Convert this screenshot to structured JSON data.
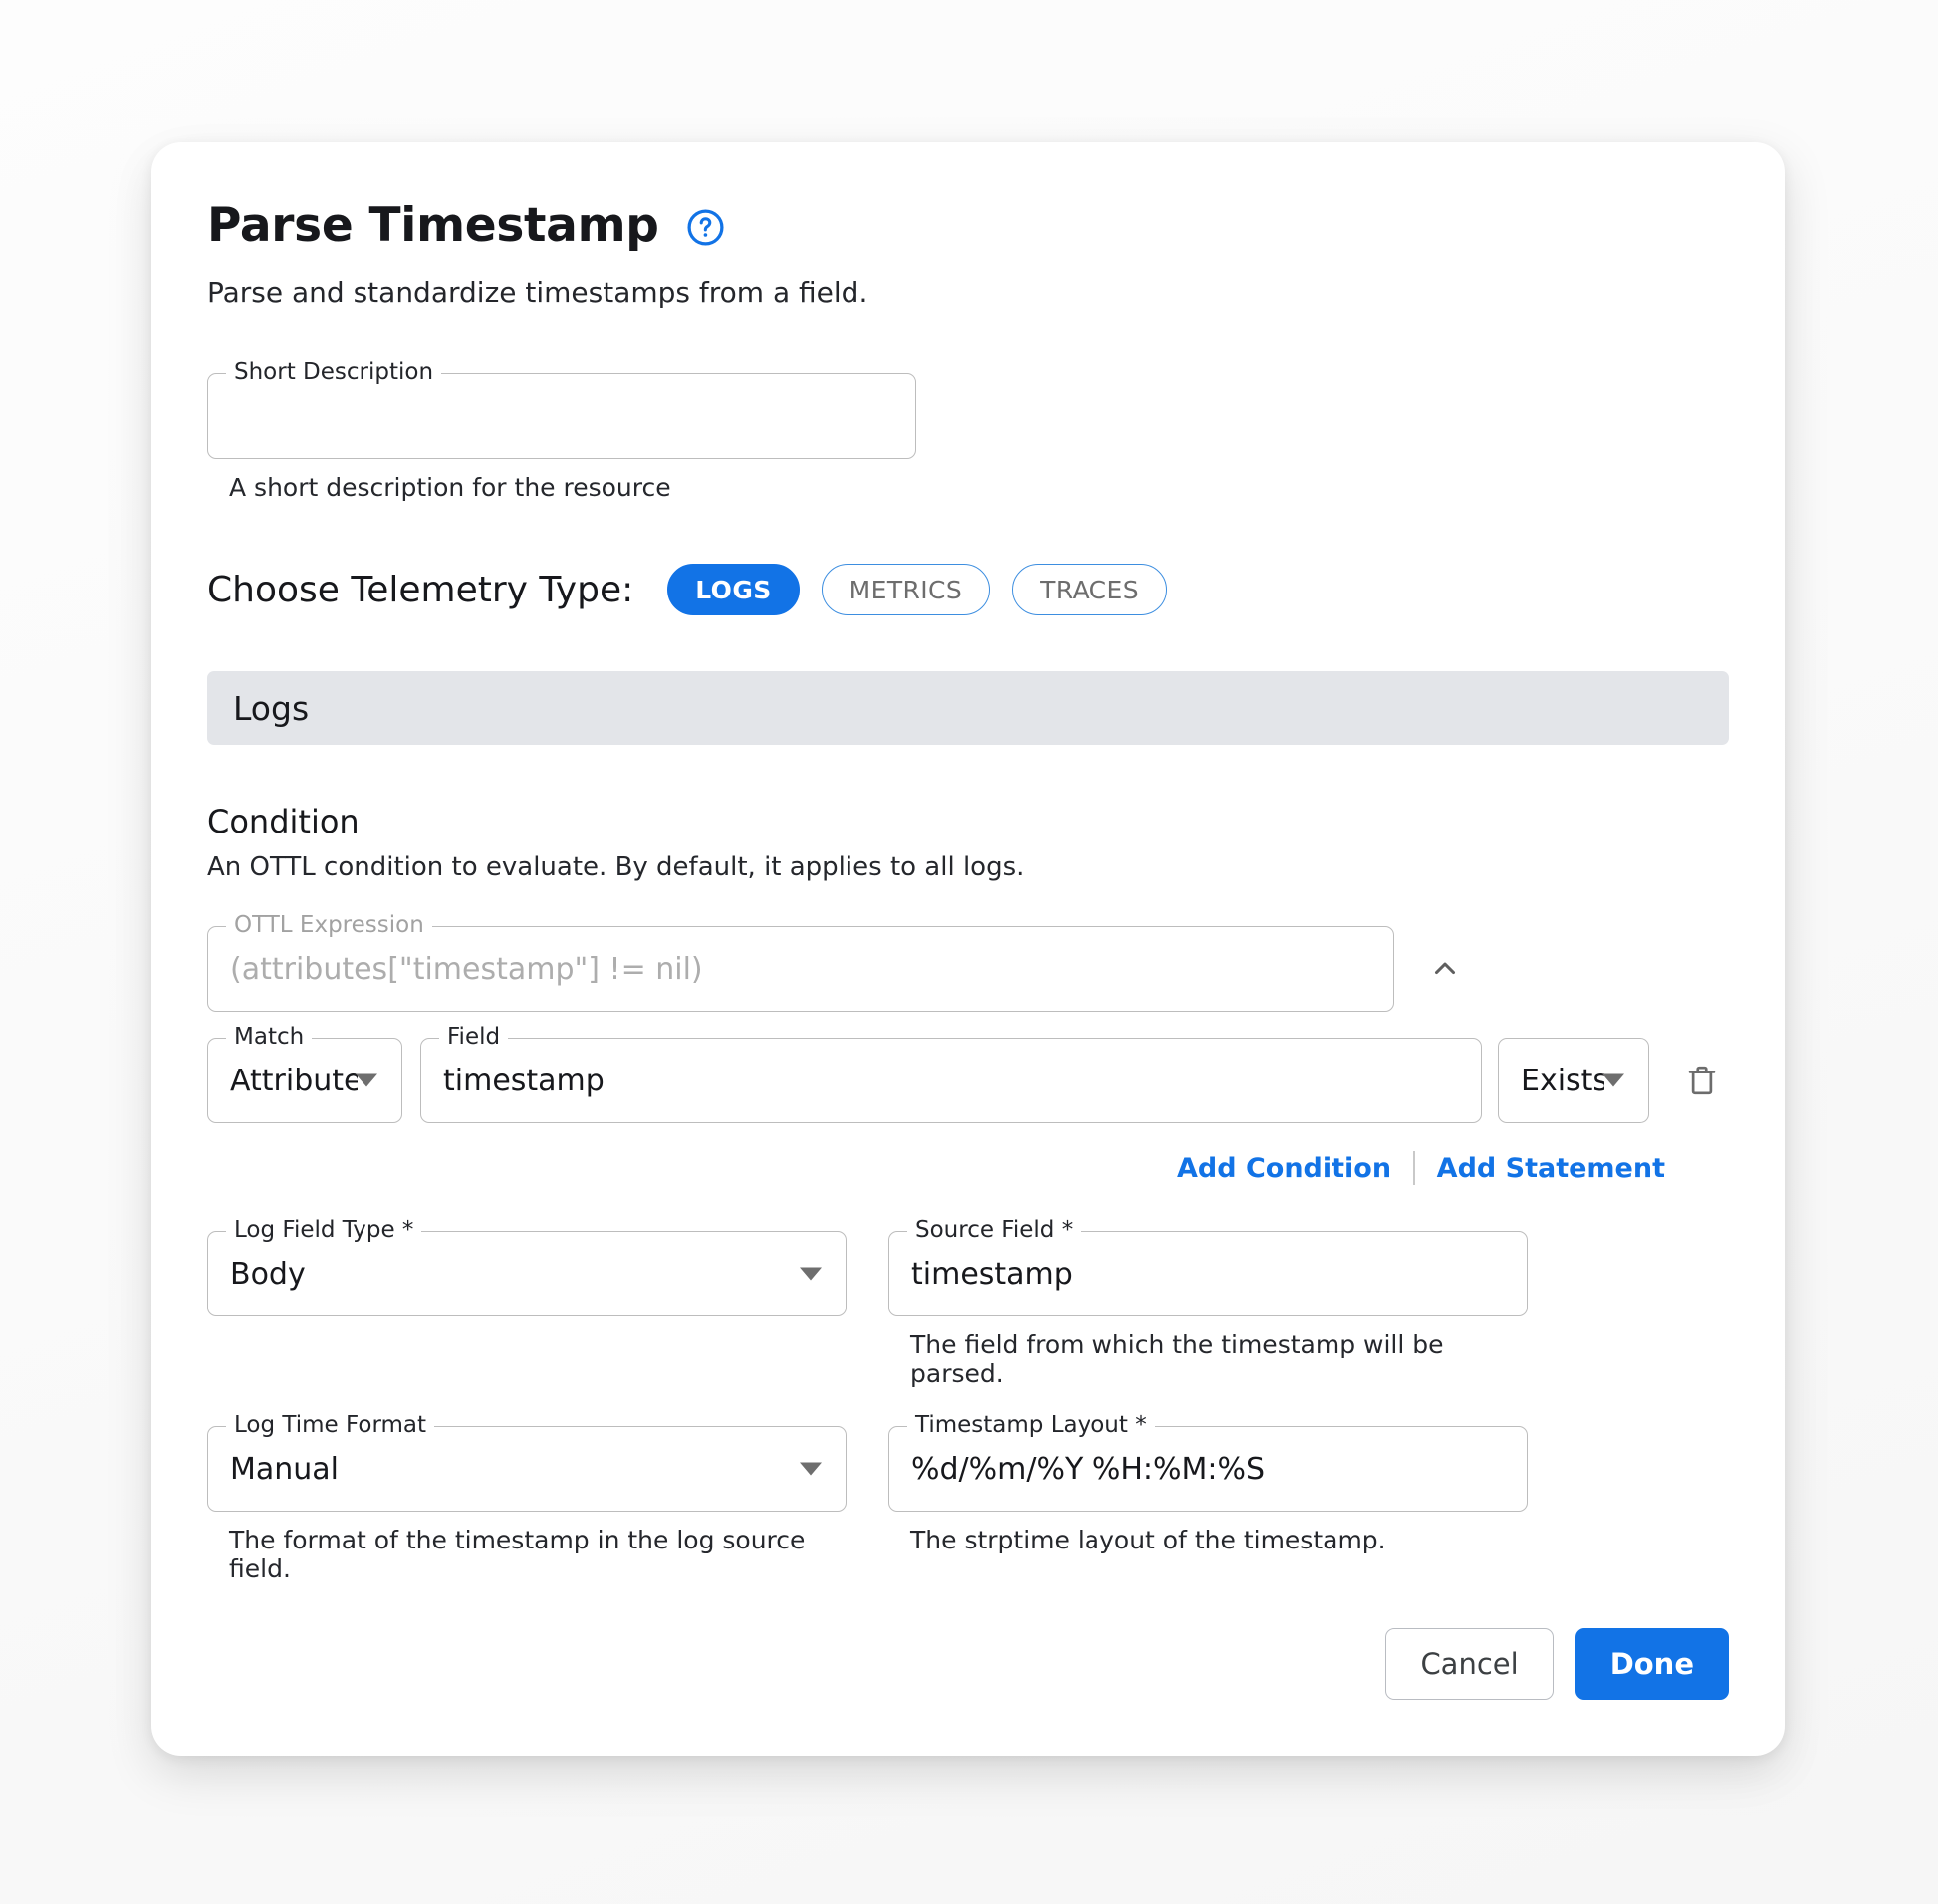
{
  "dialog": {
    "title": "Parse Timestamp",
    "help_icon": "help-circle-icon",
    "subtitle": "Parse and standardize timestamps from a field."
  },
  "short_description": {
    "label": "Short Description",
    "value": "",
    "helper": "A short description for the resource"
  },
  "telemetry": {
    "label": "Choose Telemetry Type:",
    "options": [
      {
        "label": "LOGS",
        "selected": true
      },
      {
        "label": "METRICS",
        "selected": false
      },
      {
        "label": "TRACES",
        "selected": false
      }
    ]
  },
  "section": {
    "title": "Logs"
  },
  "condition": {
    "title": "Condition",
    "description": "An OTTL condition to evaluate. By default, it applies to all logs.",
    "ottl": {
      "label": "OTTL Expression",
      "value": "(attributes[\"timestamp\"] != nil)",
      "disabled": true
    },
    "collapse_icon": "chevron-up-icon",
    "row": {
      "match": {
        "label": "Match",
        "value": "Attributes"
      },
      "field": {
        "label": "Field",
        "value": "timestamp"
      },
      "operator": {
        "value": "Exists"
      },
      "delete_icon": "trash-icon"
    },
    "links": {
      "add_condition": "Add Condition",
      "add_statement": "Add Statement"
    }
  },
  "fields": {
    "log_field_type": {
      "label": "Log Field Type *",
      "value": "Body",
      "helper": ""
    },
    "source_field": {
      "label": "Source Field *",
      "value": "timestamp",
      "helper": "The field from which the timestamp will be parsed."
    },
    "log_time_format": {
      "label": "Log Time Format",
      "value": "Manual",
      "helper": "The format of the timestamp in the log source field."
    },
    "timestamp_layout": {
      "label": "Timestamp Layout *",
      "value": "%d/%m/%Y %H:%M:%S",
      "helper": "The strptime layout of the timestamp."
    }
  },
  "footer": {
    "cancel": "Cancel",
    "done": "Done"
  },
  "colors": {
    "accent": "#1273e6",
    "link": "#1273e6",
    "section_bar": "#e3e5e9",
    "border": "#bdbdbd",
    "disabled_text": "#adadad"
  }
}
